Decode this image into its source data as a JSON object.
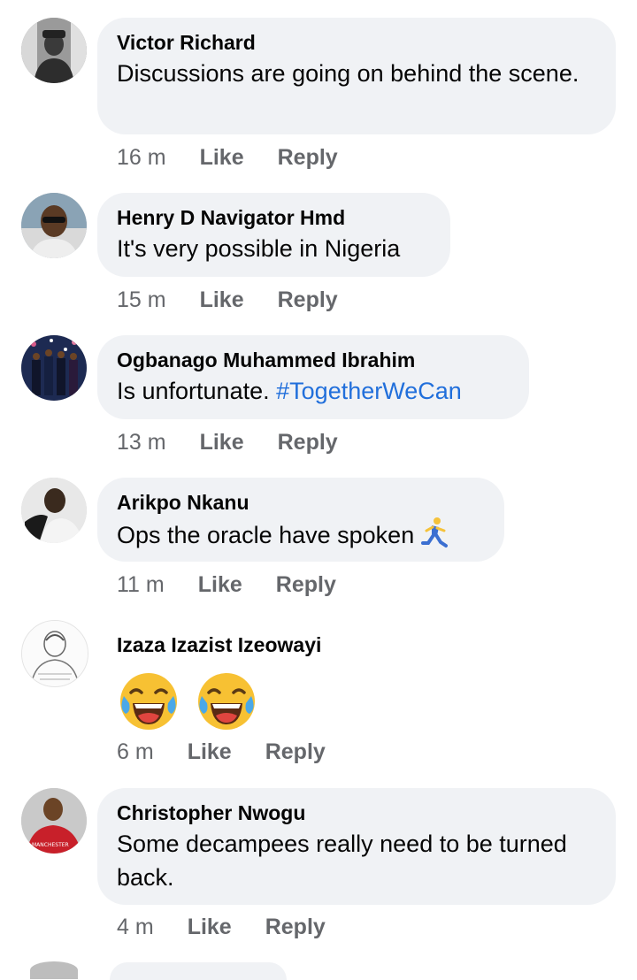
{
  "comments": [
    {
      "name": "Victor Richard",
      "text": "Discussions are going on behind the scene.",
      "time": "16 m",
      "like": "Like",
      "reply": "Reply"
    },
    {
      "name": "Henry D Navigator Hmd",
      "text": "It's very possible in Nigeria",
      "time": "15 m",
      "like": "Like",
      "reply": "Reply"
    },
    {
      "name": "Ogbanago Muhammed Ibrahim",
      "text": "Is unfortunate.",
      "hashtag": "#TogetherWeCan",
      "time": "13 m",
      "like": "Like",
      "reply": "Reply"
    },
    {
      "name": "Arikpo Nkanu",
      "text": "Ops the oracle have spoken",
      "emoji": "running-person-emoji",
      "time": "11 m",
      "like": "Like",
      "reply": "Reply"
    },
    {
      "name": "Izaza Izazist Izeowayi",
      "emoji": [
        "laughing-tears-emoji",
        "laughing-tears-emoji"
      ],
      "time": "6 m",
      "like": "Like",
      "reply": "Reply"
    },
    {
      "name": "Christopher Nwogu",
      "text": "Some decampees really need to be turned back.",
      "time": "4 m",
      "like": "Like",
      "reply": "Reply",
      "avatar_text": "MANCHESTER"
    }
  ],
  "colors": {
    "bubble": "#f0f2f5",
    "meta": "#65676b",
    "link": "#216fdb",
    "text": "#050505"
  }
}
